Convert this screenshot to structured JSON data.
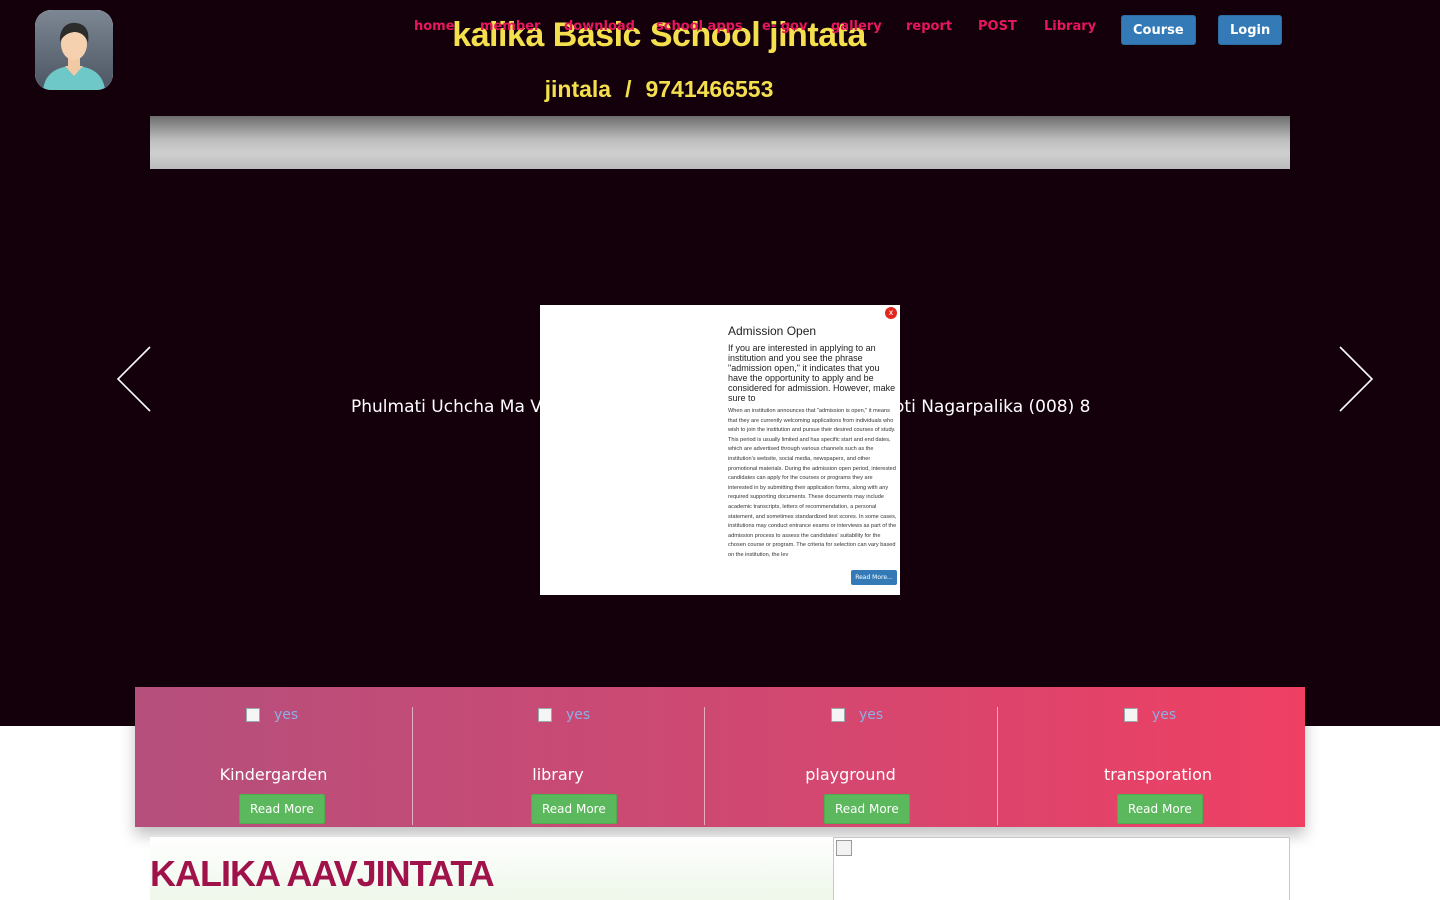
{
  "header": {
    "title": "kalika Basic School jintata",
    "location": "jintala",
    "separator": "/",
    "phone": "9741466553"
  },
  "nav": {
    "links": [
      "home",
      "member",
      "download",
      "school apps",
      "e- gov",
      "gallery",
      "report",
      "POST",
      "Library"
    ],
    "buttons": [
      "Course",
      "Login"
    ]
  },
  "slider": {
    "caption": "Phulmati Uchcha Ma Vi Kailari Gaupalika (006) (8) (Adarsha) Bhajni Tikapur Gauri Ganga Godavari Krishnapur Kaharpur, Punarbas Bedkot Belauri Shuklaphanta Mahakali Bhimdatt Parshuram Dashrathchand Purchaudi Shailyashikhar Amargadhi Ajaymeru Bhageshwar Ganyapdhura Nawadurga Alital Bhimdatt Belauri Mahakali Dodhara Chandani Laljhadi Beldandi Krishnapur Kanchanpur Dhangadhi Tikapur Lamki Chuha Ghodaghodi Gauriganga Kailari Janaki Joshipur Bardagoriya Mohanyal Chure Bhajani Godawari Kailali Kanchanpur Sudurpashchim Pradesh Nepal ... Jyoti Nagarpalika (008) 8",
    "caption_left": "Phulmati Uchcha Ma V",
    "caption_right": "oti Nagarpalika (008) 8"
  },
  "popup": {
    "close": "x",
    "title": "Admission Open",
    "lead": "If you are interested in applying to an institution and you see the phrase \"admission open,\" it indicates that you have the opportunity to apply and be considered for admission. However, make sure to",
    "body": "When an institution announces that \"admission is open,\" it means that they are currently welcoming applications from individuals who wish to join the institution and pursue their desired courses of study. This period is usually limited and has specific start and end dates, which are advertised through various channels such as the institution's website, social media, newspapers, and other promotional materials. During the admission open period, interested candidates can apply for the courses or programs they are interested in by submitting their application forms, along with any required supporting documents. These documents may include academic transcripts, letters of recommendation, a personal statement, and sometimes standardized test scores. In some cases, institutions may conduct entrance exams or interviews as part of the admission process to assess the candidates' suitability for the chosen course or program. The criteria for selection can vary based on the institution, the lev",
    "button": "Read More..."
  },
  "services": [
    {
      "alt": "yes",
      "title": "Kindergarden",
      "button": "Read More"
    },
    {
      "alt": "yes",
      "title": "library",
      "button": "Read More"
    },
    {
      "alt": "yes",
      "title": "playground",
      "button": "Read More"
    },
    {
      "alt": "yes",
      "title": "transporation",
      "button": "Read More"
    }
  ],
  "section": {
    "heading": "KALIKA AAVJINTATA"
  }
}
